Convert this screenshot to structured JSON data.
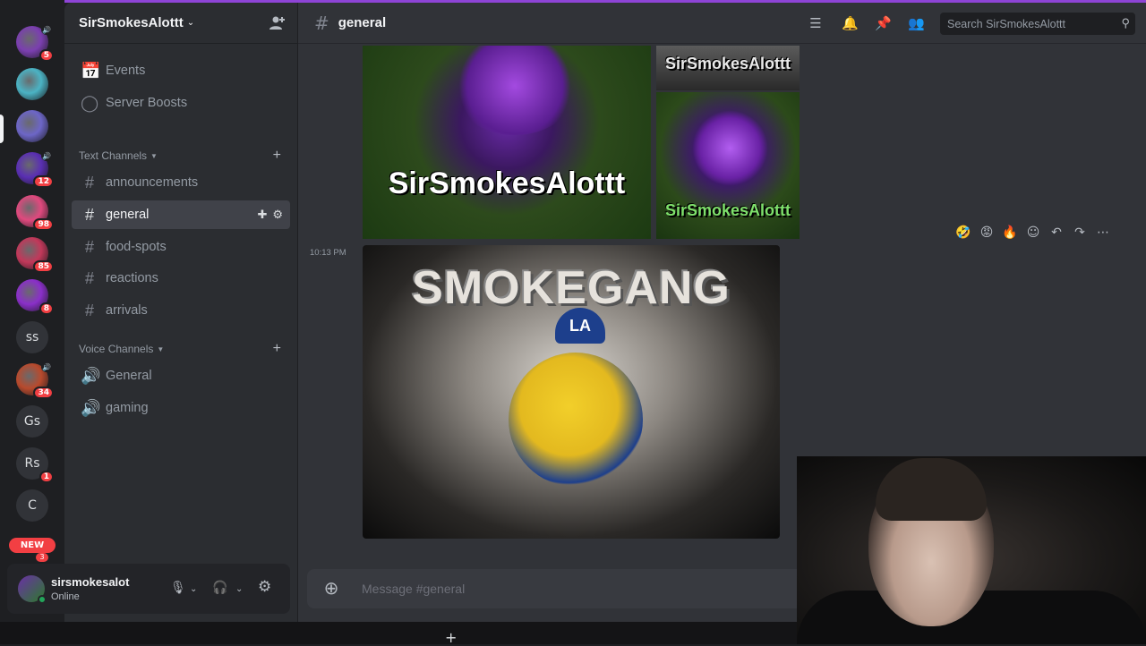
{
  "rail": {
    "servers": [
      {
        "kind": "pic",
        "color": "#7b3fb0",
        "badge": "5",
        "speaker": true
      },
      {
        "kind": "pic",
        "color": "#4bb3c4",
        "badge": "",
        "speaker": false
      },
      {
        "kind": "pic",
        "color": "#6d66c7",
        "badge": "",
        "speaker": false,
        "active": true
      },
      {
        "kind": "pic",
        "color": "#5a2fb3",
        "badge": "12",
        "speaker": true
      },
      {
        "kind": "pic",
        "color": "#e0497e",
        "badge": "98",
        "speaker": false
      },
      {
        "kind": "pic",
        "color": "#c2385a",
        "badge": "85",
        "speaker": false
      },
      {
        "kind": "pic",
        "color": "#8a2fc9",
        "badge": "8",
        "speaker": false
      },
      {
        "kind": "letters",
        "text": "ss",
        "badge": ""
      },
      {
        "kind": "pic",
        "color": "#b84a2d",
        "badge": "34",
        "speaker": true
      },
      {
        "kind": "letters",
        "text": "Gs",
        "badge": ""
      },
      {
        "kind": "letters",
        "text": "Rs",
        "badge": "1"
      },
      {
        "kind": "letters",
        "text": "C",
        "badge": ""
      }
    ],
    "new_label": "NEW",
    "under_new_badge": "3"
  },
  "server": {
    "name": "SirSmokesAlottt"
  },
  "sidebar": {
    "top_items": [
      {
        "icon": "calendar-icon",
        "label": "Events"
      },
      {
        "icon": "boost-icon",
        "label": "Server Boosts"
      }
    ],
    "text_category": "Text Channels",
    "text_channels": [
      "announcements",
      "general",
      "food-spots",
      "reactions",
      "arrivals"
    ],
    "active_channel": "general",
    "voice_category": "Voice Channels",
    "voice_channels": [
      "General",
      "gaming"
    ]
  },
  "user": {
    "name": "sirsmokesalot",
    "status": "Online"
  },
  "header": {
    "channel": "general",
    "search_placeholder": "Search SirSmokesAlottt"
  },
  "messages": {
    "time": "10:13 PM",
    "image_a_text": "SirSmokesAlottt",
    "image_b_text": "SirSmokesAlottt",
    "image_c_text": "SirSmokesAlottt",
    "image_d_text": "SMOKEGANG",
    "image_d_cap_text": "LA"
  },
  "composer": {
    "placeholder": "Message #general"
  },
  "colors": {
    "accent": "#8e44d6",
    "online": "#23a55a",
    "badge": "#f23f43"
  }
}
